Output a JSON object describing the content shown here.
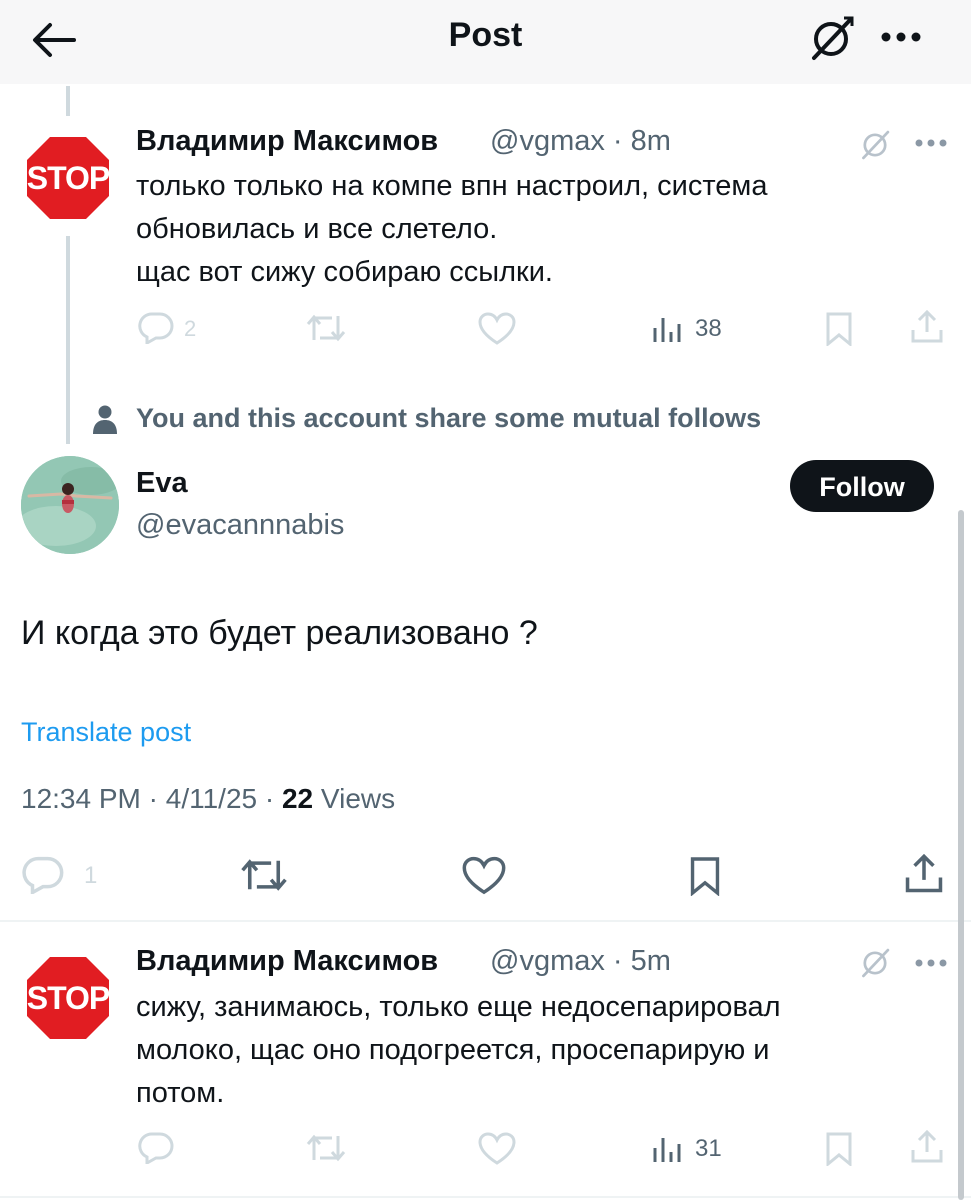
{
  "header": {
    "title": "Post",
    "back_icon": "arrow-left-icon",
    "grok_icon": "grok-icon",
    "more_icon": "more-icon"
  },
  "reply_above": {
    "avatar_text": "STOP",
    "name": "Владимир Максимов",
    "handle": "@vgmax",
    "time": "8m",
    "text_lines": [
      "только только на компе впн настроил, система",
      "обновилась и все слетело.",
      "щас вот сижу собираю ссылки."
    ],
    "replies": "2",
    "views": "38"
  },
  "mutual_follows": "You and this account share some mutual follows",
  "main_post": {
    "name": "Eva",
    "handle": "@evacannnabis",
    "follow_label": "Follow",
    "text": "И когда это будет реализовано ?",
    "translate": "Translate post",
    "time": "12:34 PM",
    "date": "4/11/25",
    "views_count": "22",
    "views_label": "Views",
    "replies": "1"
  },
  "reply_below": {
    "avatar_text": "STOP",
    "name": "Владимир Максимов",
    "handle": "@vgmax",
    "time": "5m",
    "text_lines": [
      "сижу, занимаюсь, только еще недосепарировал",
      "молоко, щас оно подогреется, просепарирую и",
      "потом."
    ],
    "views": "31"
  },
  "colors": {
    "accent": "#1d9bf0",
    "text": "#0f1419",
    "secondary": "#536471",
    "stop_red": "#e11d22"
  }
}
